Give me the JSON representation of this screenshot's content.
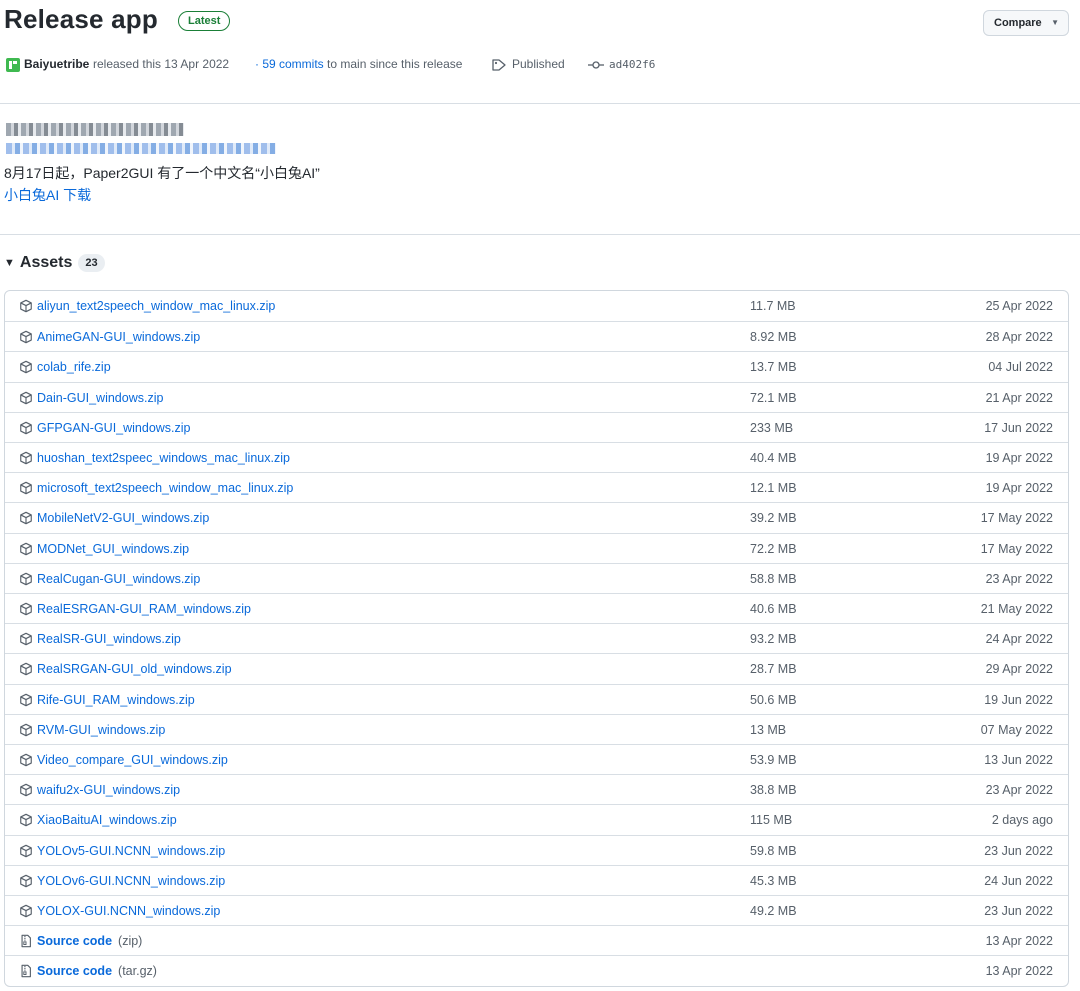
{
  "release": {
    "title": "Release app",
    "badge": "Latest",
    "compare_label": "Compare",
    "author": "Baiyuetribe",
    "released_text": "released this 13 Apr 2022",
    "commits_link": "· 59 commits",
    "commits_suffix": " to main since this release",
    "published_label": "Published",
    "commit_sha": "ad402f6"
  },
  "notes": {
    "line1": "8月17日起，Paper2GUI 有了一个中文名“小白兔AI”",
    "link": "小白兔AI 下载"
  },
  "assets": {
    "heading": "Assets",
    "count": "23",
    "items": [
      {
        "name": "aliyun_text2speech_window_mac_linux.zip",
        "size": "11.7 MB",
        "date": "25 Apr 2022",
        "icon": "package-icon"
      },
      {
        "name": "AnimeGAN-GUI_windows.zip",
        "size": "8.92 MB",
        "date": "28 Apr 2022",
        "icon": "package-icon"
      },
      {
        "name": "colab_rife.zip",
        "size": "13.7 MB",
        "date": "04 Jul 2022",
        "icon": "package-icon"
      },
      {
        "name": "Dain-GUI_windows.zip",
        "size": "72.1 MB",
        "date": "21 Apr 2022",
        "icon": "package-icon"
      },
      {
        "name": "GFPGAN-GUI_windows.zip",
        "size": "233 MB",
        "date": "17 Jun 2022",
        "icon": "package-icon"
      },
      {
        "name": "huoshan_text2speec_windows_mac_linux.zip",
        "size": "40.4 MB",
        "date": "19 Apr 2022",
        "icon": "package-icon"
      },
      {
        "name": "microsoft_text2speech_window_mac_linux.zip",
        "size": "12.1 MB",
        "date": "19 Apr 2022",
        "icon": "package-icon"
      },
      {
        "name": "MobileNetV2-GUI_windows.zip",
        "size": "39.2 MB",
        "date": "17 May 2022",
        "icon": "package-icon"
      },
      {
        "name": "MODNet_GUI_windows.zip",
        "size": "72.2 MB",
        "date": "17 May 2022",
        "icon": "package-icon"
      },
      {
        "name": "RealCugan-GUI_windows.zip",
        "size": "58.8 MB",
        "date": "23 Apr 2022",
        "icon": "package-icon"
      },
      {
        "name": "RealESRGAN-GUI_RAM_windows.zip",
        "size": "40.6 MB",
        "date": "21 May 2022",
        "icon": "package-icon"
      },
      {
        "name": "RealSR-GUI_windows.zip",
        "size": "93.2 MB",
        "date": "24 Apr 2022",
        "icon": "package-icon"
      },
      {
        "name": "RealSRGAN-GUI_old_windows.zip",
        "size": "28.7 MB",
        "date": "29 Apr 2022",
        "icon": "package-icon"
      },
      {
        "name": "Rife-GUI_RAM_windows.zip",
        "size": "50.6 MB",
        "date": "19 Jun 2022",
        "icon": "package-icon"
      },
      {
        "name": "RVM-GUI_windows.zip",
        "size": "13 MB",
        "date": "07 May 2022",
        "icon": "package-icon"
      },
      {
        "name": "Video_compare_GUI_windows.zip",
        "size": "53.9 MB",
        "date": "13 Jun 2022",
        "icon": "package-icon"
      },
      {
        "name": "waifu2x-GUI_windows.zip",
        "size": "38.8 MB",
        "date": "23 Apr 2022",
        "icon": "package-icon"
      },
      {
        "name": "XiaoBaituAI_windows.zip",
        "size": "115 MB",
        "date": "2 days ago",
        "icon": "package-icon"
      },
      {
        "name": "YOLOv5-GUI.NCNN_windows.zip",
        "size": "59.8 MB",
        "date": "23 Jun 2022",
        "icon": "package-icon"
      },
      {
        "name": "YOLOv6-GUI.NCNN_windows.zip",
        "size": "45.3 MB",
        "date": "24 Jun 2022",
        "icon": "package-icon"
      },
      {
        "name": "YOLOX-GUI.NCNN_windows.zip",
        "size": "49.2 MB",
        "date": "23 Jun 2022",
        "icon": "package-icon"
      },
      {
        "name": "Source code",
        "suffix": "(zip)",
        "size": "",
        "date": "13 Apr 2022",
        "icon": "file-zip-icon"
      },
      {
        "name": "Source code",
        "suffix": "(tar.gz)",
        "size": "",
        "date": "13 Apr 2022",
        "icon": "file-zip-icon"
      }
    ]
  }
}
